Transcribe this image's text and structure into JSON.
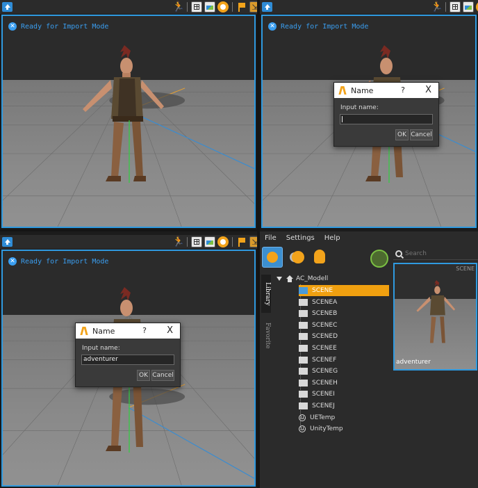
{
  "viewports": [
    {
      "id": "tl",
      "status": "Ready for Import Mode"
    },
    {
      "id": "tr",
      "status": "Ready for Import Mode",
      "dialog": {
        "title": "Name",
        "help": "?",
        "close": "X",
        "label": "Input name:",
        "value": "",
        "ok": "OK",
        "cancel": "Cancel"
      }
    },
    {
      "id": "bl",
      "status": "Ready for Import Mode",
      "dialog": {
        "title": "Name",
        "help": "?",
        "close": "X",
        "label": "Input name:",
        "value": "adventurer",
        "ok": "OK",
        "cancel": "Cancel"
      }
    }
  ],
  "content_manager": {
    "menu": [
      "File",
      "Settings",
      "Help"
    ],
    "side_tabs": {
      "library": "Library",
      "favorite": "Favorite"
    },
    "search_placeholder": "Search",
    "tree_root": "AC_Modell",
    "tree_items": [
      {
        "label": "SCENE",
        "type": "folder",
        "selected": true
      },
      {
        "label": "SCENEA",
        "type": "folder"
      },
      {
        "label": "SCENEB",
        "type": "folder"
      },
      {
        "label": "SCENEC",
        "type": "folder"
      },
      {
        "label": "SCENED",
        "type": "folder"
      },
      {
        "label": "SCENEE",
        "type": "folder"
      },
      {
        "label": "SCENEF",
        "type": "folder"
      },
      {
        "label": "SCENEG",
        "type": "folder"
      },
      {
        "label": "SCENEH",
        "type": "folder"
      },
      {
        "label": "SCENEI",
        "type": "folder"
      },
      {
        "label": "SCENEJ",
        "type": "folder"
      },
      {
        "label": "UETemp",
        "type": "unity"
      },
      {
        "label": "UnityTemp",
        "type": "unity"
      }
    ],
    "thumbnail": {
      "tag": "SCENE",
      "label": "adventurer"
    }
  },
  "colors": {
    "accent": "#2f9ae0",
    "highlight": "#f0a010",
    "status": "#3a9ef0"
  }
}
